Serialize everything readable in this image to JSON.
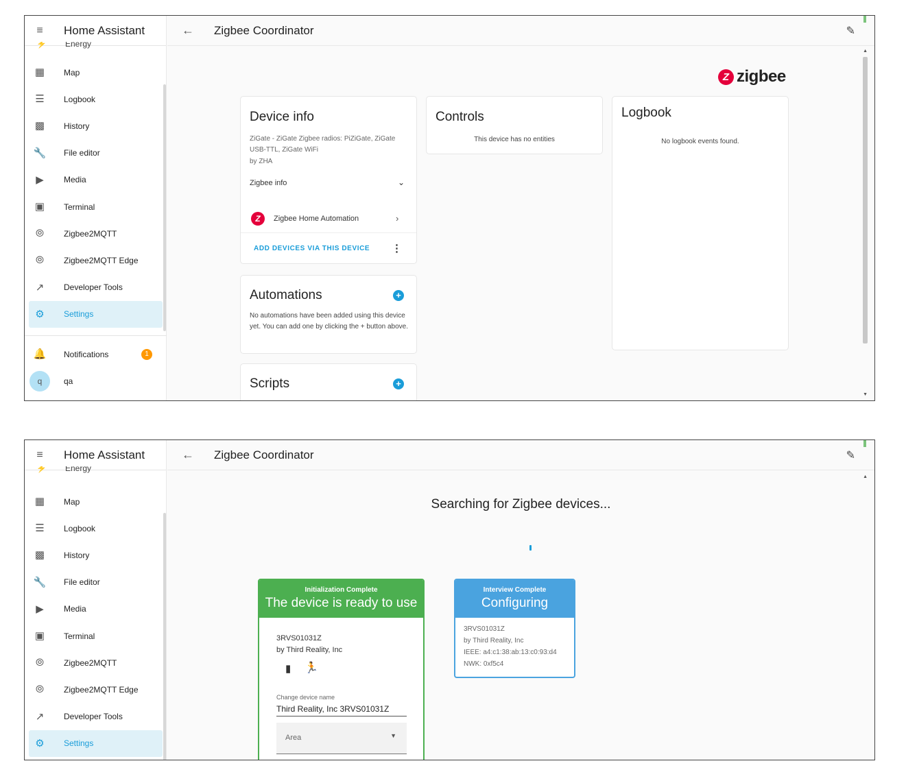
{
  "app_title": "Home Assistant",
  "page_title": "Zigbee Coordinator",
  "sidebar": {
    "cut_item": "Energy",
    "items": [
      {
        "label": "Map",
        "icon": "map-icon"
      },
      {
        "label": "Logbook",
        "icon": "logbook-icon"
      },
      {
        "label": "History",
        "icon": "history-icon"
      },
      {
        "label": "File editor",
        "icon": "wrench-icon"
      },
      {
        "label": "Media",
        "icon": "media-icon"
      },
      {
        "label": "Terminal",
        "icon": "terminal-icon"
      },
      {
        "label": "Zigbee2MQTT",
        "icon": "zigbee2mqtt-icon"
      },
      {
        "label": "Zigbee2MQTT Edge",
        "icon": "zigbee2mqtt-edge-icon"
      },
      {
        "label": "Developer Tools",
        "icon": "hammer-icon"
      },
      {
        "label": "Settings",
        "icon": "gear-icon"
      }
    ],
    "notifications_label": "Notifications",
    "notifications_count": "1",
    "user_initial": "q",
    "user_name": "qa"
  },
  "screen1": {
    "logo_text": "zigbee",
    "device_info": {
      "title": "Device info",
      "description": "ZiGate - ZiGate Zigbee radios: PiZiGate, ZiGate USB-TTL, ZiGate WiFi",
      "manufacturer": "by ZHA",
      "zigbee_info_label": "Zigbee info",
      "integration_label": "Zigbee Home Automation",
      "add_devices_label": "ADD DEVICES VIA THIS DEVICE"
    },
    "controls": {
      "title": "Controls",
      "empty_text": "This device has no entities"
    },
    "logbook": {
      "title": "Logbook",
      "empty_text": "No logbook events found."
    },
    "automations": {
      "title": "Automations",
      "empty_text": "No automations have been added using this device yet. You can add one by clicking the + button above."
    },
    "scripts": {
      "title": "Scripts"
    }
  },
  "screen2": {
    "heading": "Searching for Zigbee devices...",
    "device_ready": {
      "status": "Initialization Complete",
      "stage": "The device is ready to use",
      "model": "3RVS01031Z",
      "manufacturer": "by Third Reality, Inc",
      "change_name_label": "Change device name",
      "name_value": "Third Reality, Inc 3RVS01031Z",
      "area_placeholder": "Area"
    },
    "device_configuring": {
      "status": "Interview Complete",
      "stage": "Configuring",
      "model": "3RVS01031Z",
      "manufacturer": "by Third Reality, Inc",
      "ieee": "IEEE: a4:c1:38:ab:13:c0:93:d4",
      "nwk": "NWK: 0xf5c4"
    }
  },
  "colors": {
    "accent": "#1a9dd9",
    "ready_green": "#4caf50",
    "configuring_blue": "#4aa3df",
    "zigbee_red": "#e4003b",
    "badge_orange": "#ff9800"
  }
}
